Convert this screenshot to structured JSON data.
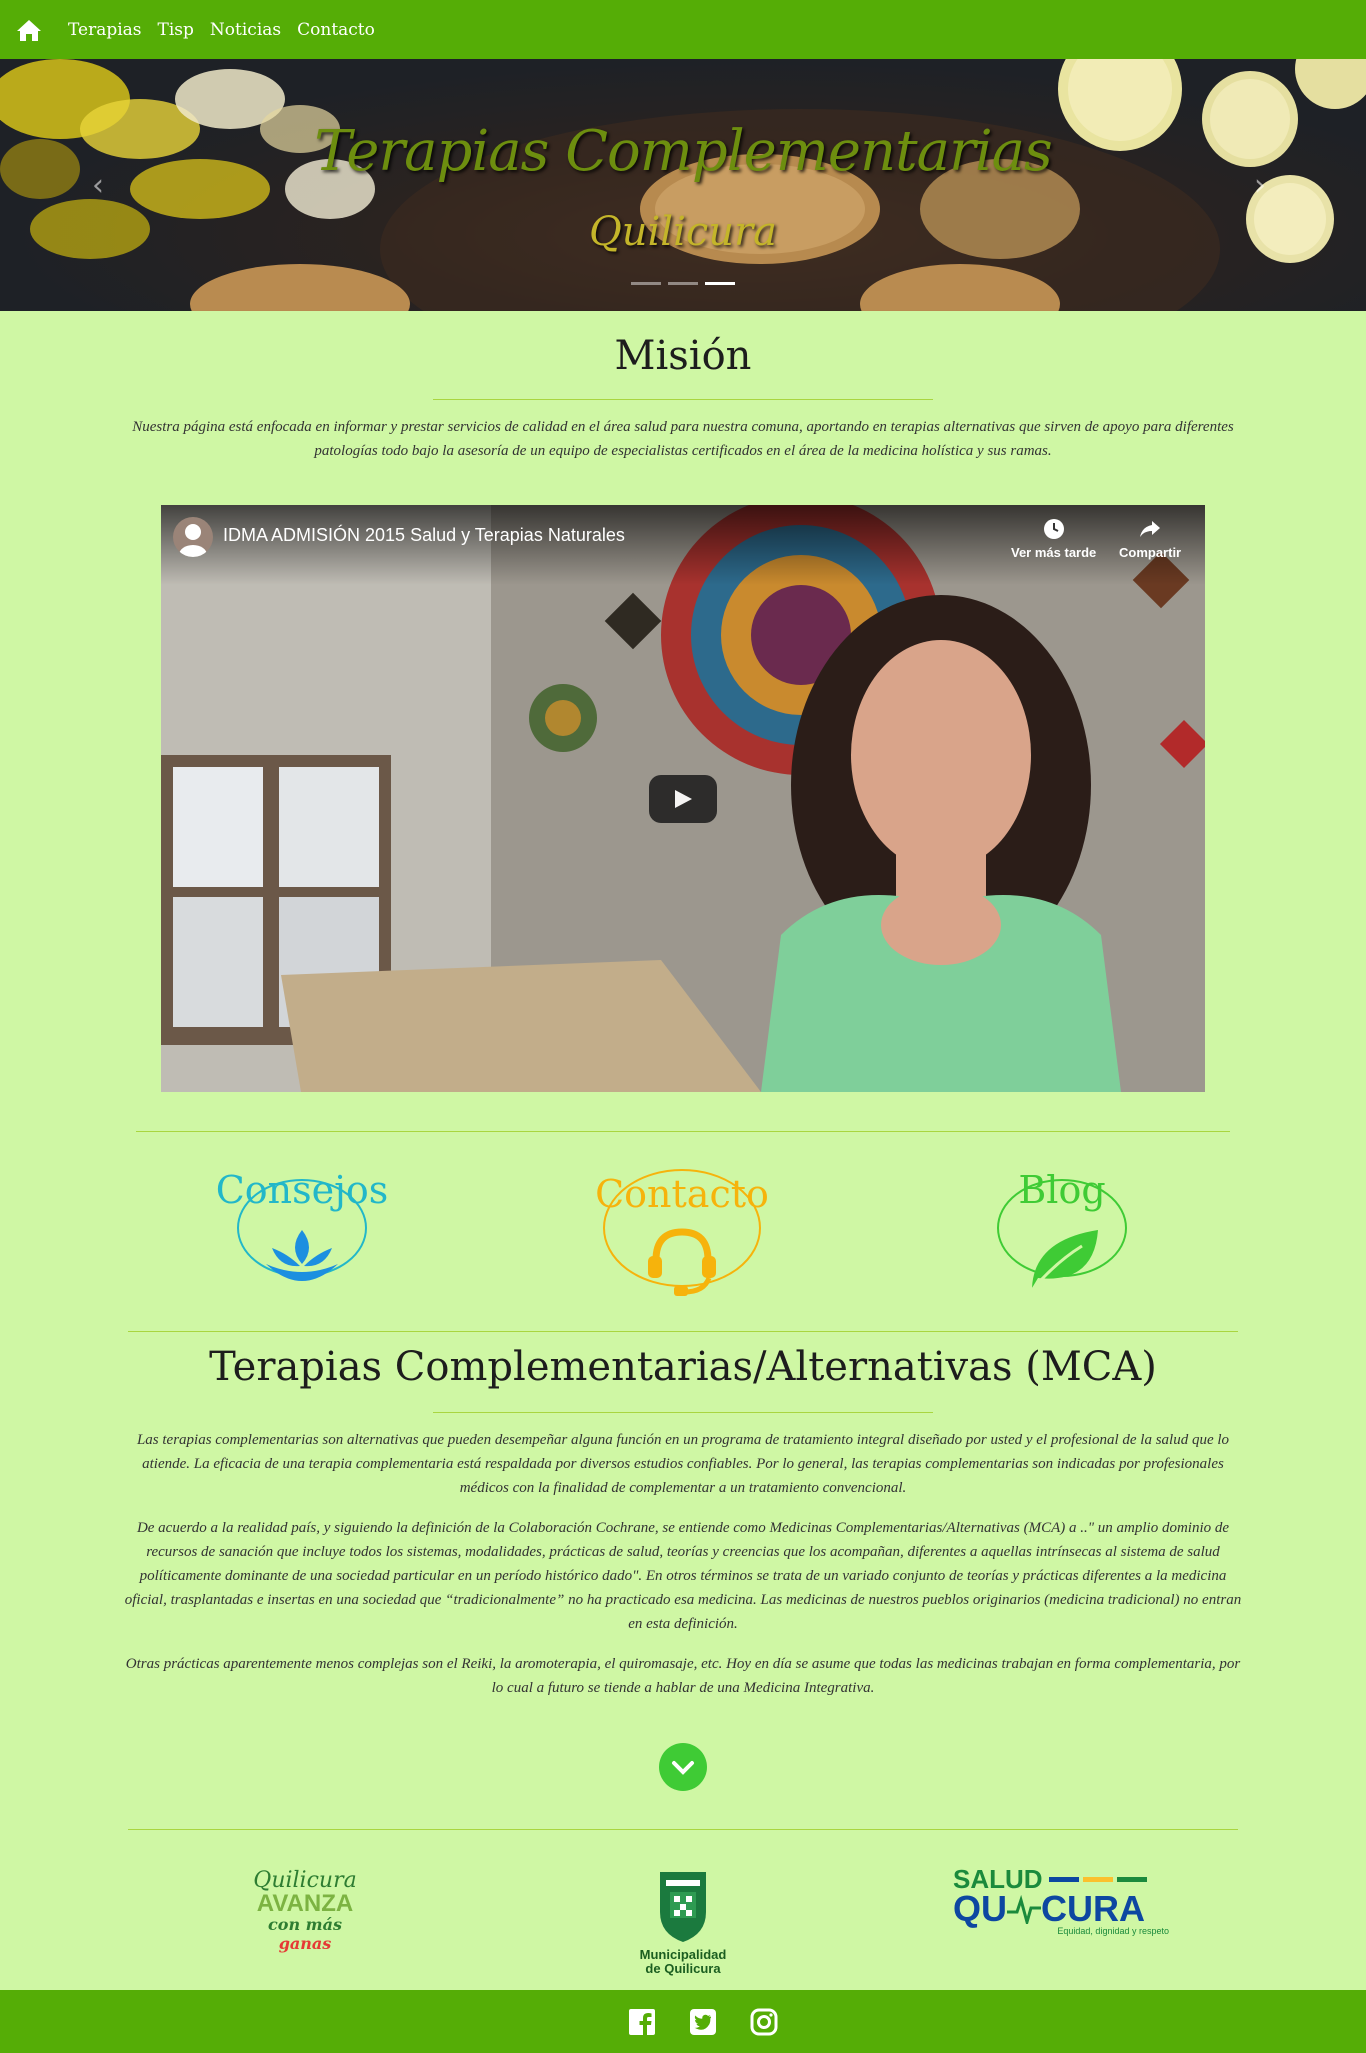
{
  "nav": {
    "home_icon": "home-icon",
    "links": [
      "Terapias",
      "Tisp",
      "Noticias",
      "Contacto"
    ]
  },
  "hero": {
    "title": "Terapias Complementarias",
    "subtitle": "Quilicura",
    "prev_icon": "chevron-left-icon",
    "next_icon": "chevron-right-icon",
    "slides": 3,
    "active_slide": 3
  },
  "mision": {
    "title": "Misión",
    "text_line1": "Nuestra página está enfocada en informar y prestar servicios de calidad en el área salud para nuestra comuna, aportando en terapias alternativas que sirven de apoyo para diferentes",
    "text_line2": "patologías todo bajo la asesoría de un equipo de especialistas certificados en el área de la medicina holística y sus ramas."
  },
  "video": {
    "title": "IDMA ADMISIÓN 2015 Salud y Terapias Naturales",
    "watch_later": "Ver más tarde",
    "share": "Compartir"
  },
  "quick_links": [
    {
      "label": "Consejos",
      "icon": "lotus-icon",
      "color": "#22b7c9"
    },
    {
      "label": "Contacto",
      "icon": "headset-icon",
      "color": "#f6b30c"
    },
    {
      "label": "Blog",
      "icon": "leaf-icon",
      "color": "#3fcb35"
    }
  ],
  "mca": {
    "title": "Terapias Complementarias/Alternativas (MCA)",
    "p1": [
      "Las terapias complementarias son alternativas que pueden desempeñar alguna función en un programa de tratamiento integral diseñado por usted y el profesional de la salud que lo",
      "atiende. La eficacia de una terapia complementaria está respaldada por diversos estudios confiables. Por lo general, las terapias complementarias son indicadas por profesionales",
      "médicos con la finalidad de complementar a un tratamiento convencional."
    ],
    "p2": [
      "De acuerdo a la realidad país, y siguiendo la definición de la Colaboración Cochrane, se entiende como Medicinas Complementarias/Alternativas (MCA) a ..\" un amplio dominio de",
      "recursos de sanación que incluye todos los sistemas, modalidades, prácticas de salud, teorías y creencias que los acompañan, diferentes a aquellas intrínsecas al sistema de salud",
      "políticamente dominante de una sociedad particular en un período histórico dado\". En otros términos se trata de un variado conjunto de teorías y prácticas diferentes a la medicina",
      "oficial, trasplantadas e insertas en una sociedad que “tradicionalmente” no ha practicado esa medicina. Las medicinas de nuestros pueblos originarios (medicina tradicional) no entran",
      "en esta definición."
    ],
    "p3": [
      "Otras prácticas aparentemente menos complejas son el Reiki, la aromoterapia, el quiromasaje, etc. Hoy en día se asume que todas las medicinas trabajan en forma complementaria, por",
      "lo cual a futuro se tiende a hablar de una Medicina Integrativa."
    ],
    "down_icon": "chevron-down-icon"
  },
  "logos": {
    "avanza": {
      "top": "Quilicura",
      "mid": "AVANZA",
      "bottom_a": "con más",
      "bottom_b": "ganas"
    },
    "municipalidad": {
      "line1": "Municipalidad",
      "line2": "de Quilicura"
    },
    "salud": {
      "line1": "SALUD",
      "line2a": "QU",
      "line2b": "CURA",
      "tagline": "Equidad, dignidad y respeto"
    }
  },
  "footer": {
    "icons": [
      "facebook-icon",
      "twitter-icon",
      "instagram-icon"
    ]
  },
  "colors": {
    "nav_green": "#55ad06",
    "page_bg": "#cff7a4",
    "rule": "#a9d640"
  }
}
